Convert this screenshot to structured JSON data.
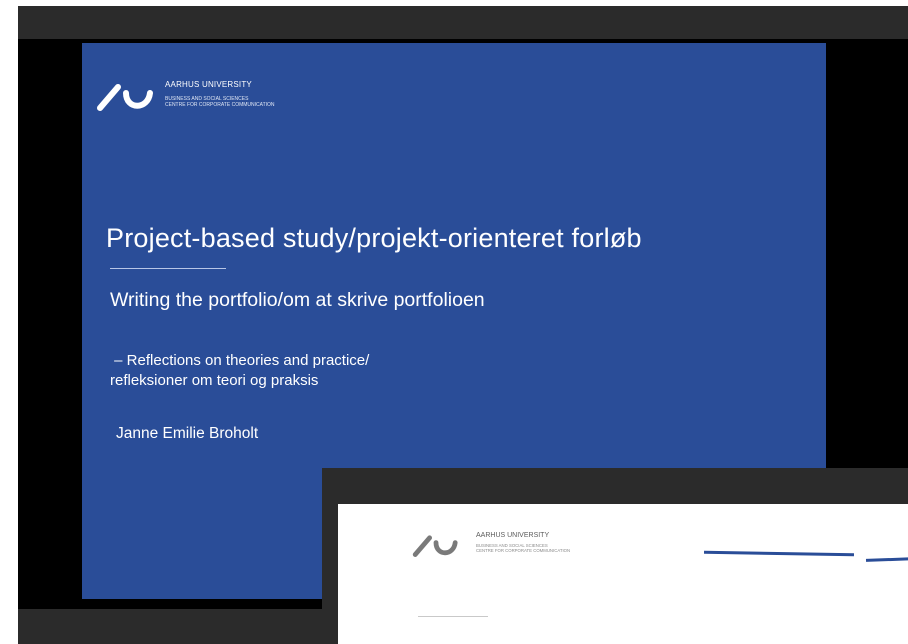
{
  "main_slide": {
    "logo_icon": "aarhus-university-logo",
    "university": "AARHUS UNIVERSITY",
    "faculty_line1": "BUSINESS AND SOCIAL SCIENCES",
    "faculty_line2": "CENTRE FOR CORPORATE COMMUNICATION",
    "title": "Project-based study/projekt-orienteret forløb",
    "subtitle": "Writing the portfolio/om at skrive portfolioen",
    "reflections_line1": " – Reflections on theories and practice/",
    "reflections_line2": "refleksioner om teori og praksis",
    "author": "Janne Emilie Broholt"
  },
  "preview_slide": {
    "logo_icon": "aarhus-university-logo",
    "university": "AARHUS UNIVERSITY",
    "faculty_line1": "BUSINESS AND SOCIAL SCIENCES",
    "faculty_line2": "CENTRE FOR CORPORATE COMMUNICATION"
  },
  "colors": {
    "slide_blue": "#2a4d98",
    "frame_dark": "#2b2b2b",
    "stage_black": "#000000"
  }
}
